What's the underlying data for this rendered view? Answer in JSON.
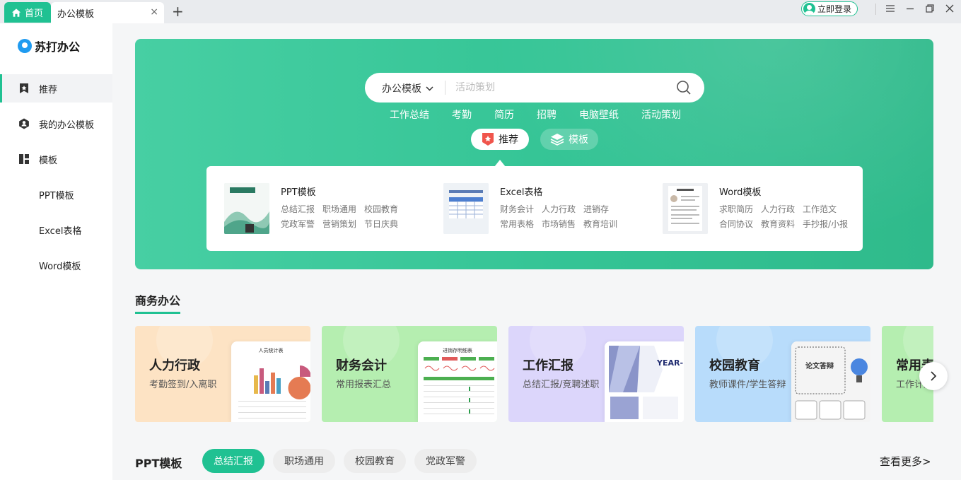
{
  "tabs": {
    "home_label": "首页",
    "active_label": "办公模板",
    "close_icon": "×",
    "add_icon": "+"
  },
  "titlebar": {
    "login_label": "立即登录"
  },
  "sidebar": {
    "logo_text": "苏打办公",
    "items": [
      {
        "label": "推荐",
        "icon": "star-bookmark-icon",
        "active": true
      },
      {
        "label": "我的办公模板",
        "icon": "user-hexagon-icon"
      },
      {
        "label": "模板",
        "icon": "grid-icon"
      },
      {
        "label": "PPT模板"
      },
      {
        "label": "Excel表格"
      },
      {
        "label": "Word模板"
      }
    ]
  },
  "search": {
    "category": "办公模板",
    "placeholder": "活动策划",
    "hot_words": [
      "工作总结",
      "考勤",
      "简历",
      "招聘",
      "电脑壁纸",
      "活动策划"
    ]
  },
  "hero_tabs": [
    {
      "label": "推荐",
      "icon": "recommend-badge-icon",
      "active": true
    },
    {
      "label": "模板",
      "icon": "layers-icon"
    }
  ],
  "categories": [
    {
      "title": "PPT模板",
      "tags": [
        "总结汇报",
        "职场通用",
        "校园教育",
        "党政军警",
        "营销策划",
        "节日庆典"
      ]
    },
    {
      "title": "Excel表格",
      "tags": [
        "财务会计",
        "人力行政",
        "进销存",
        "常用表格",
        "市场销售",
        "教育培训"
      ]
    },
    {
      "title": "Word模板",
      "tags": [
        "求职简历",
        "人力行政",
        "工作范文",
        "合同协议",
        "教育资料",
        "手抄报/小报"
      ]
    }
  ],
  "section": {
    "title": "商务办公",
    "cards": [
      {
        "title": "人力行政",
        "sub": "考勤签到/入离职",
        "color": "#fde3c4",
        "doc_title": "人员统计表"
      },
      {
        "title": "财务会计",
        "sub": "常用报表汇总",
        "color": "#b5eeb0",
        "doc_title": "进销存明细表"
      },
      {
        "title": "工作汇报",
        "sub": "总结汇报/竞聘述职",
        "color": "#dcd6fb",
        "doc_title": "YEAR-END REPORT"
      },
      {
        "title": "校园教育",
        "sub": "教师课件/学生答辩",
        "color": "#b8dcfb",
        "doc_title": "论文答辩"
      },
      {
        "title": "常用表格",
        "sub": "工作计划",
        "color": "#b5eeb0"
      }
    ]
  },
  "ppt_section": {
    "title": "PPT模板",
    "pills": [
      "总结汇报",
      "职场通用",
      "校园教育",
      "党政军警"
    ],
    "see_more": "查看更多>"
  },
  "colors": {
    "accent": "#20c192",
    "hero_gradient_start": "#47cfa3",
    "hero_gradient_end": "#2fba8b"
  }
}
